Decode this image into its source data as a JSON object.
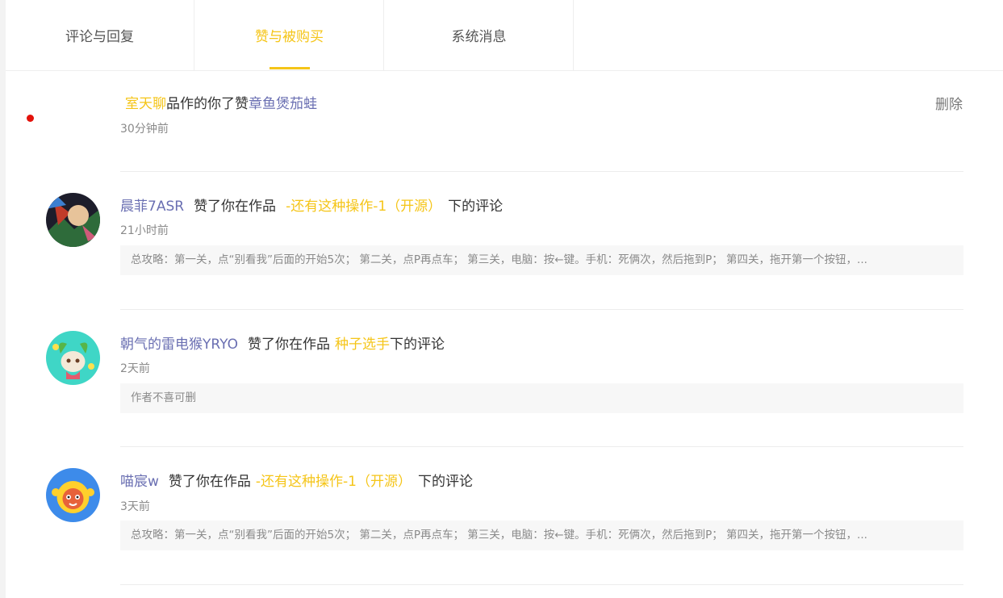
{
  "tabs": [
    {
      "label": "评论与回复"
    },
    {
      "label": "赞与被购买"
    },
    {
      "label": "系统消息"
    }
  ],
  "colors": {
    "accent": "#f5c518",
    "name": "#6a6fb2",
    "unread": "#e3120b"
  },
  "items": [
    {
      "prefix": "室天聊",
      "action": "品作的你了赞",
      "target_label": "章鱼煲茄蛙",
      "time": "30分钟前",
      "delete_label": "删除"
    },
    {
      "user": "晨菲7ASR",
      "action": "赞了你在作品",
      "work": "-还有这种操作-1（开源）",
      "suffix": "下的评论",
      "time": "21小时前",
      "quote": "总攻略：第一关，点“别看我”后面的开始5次； 第二关，点P再点车； 第三关，电脑：按←键。手机：死俩次，然后拖到P； 第四关，拖开第一个按钮，..."
    },
    {
      "user": "朝气的雷电猴YRYO",
      "action": "赞了你在作品",
      "work": "种子选手",
      "suffix": "下的评论",
      "time": "2天前",
      "quote": "作者不喜可删"
    },
    {
      "user": "喵宸w",
      "action": "赞了你在作品",
      "work": "-还有这种操作-1（开源）",
      "suffix": "下的评论",
      "time": "3天前",
      "quote": "总攻略：第一关，点“别看我”后面的开始5次； 第二关，点P再点车； 第三关，电脑：按←键。手机：死俩次，然后拖到P； 第四关，拖开第一个按钮，..."
    }
  ]
}
